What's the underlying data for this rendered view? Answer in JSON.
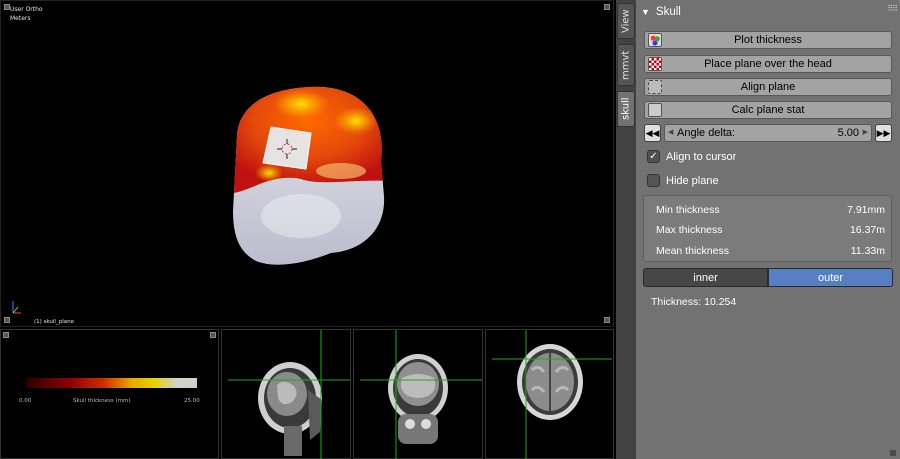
{
  "viewport": {
    "view_name": "User Ortho",
    "units": "Meters",
    "active_object": "(1) skull_plane"
  },
  "colorbar": {
    "min_label": "0.00",
    "title": "Skull thickness (mm)",
    "max_label": "25.00"
  },
  "tabs": [
    {
      "label": "View",
      "active": false
    },
    {
      "label": "mmvt",
      "active": false
    },
    {
      "label": "skull",
      "active": true
    }
  ],
  "panel": {
    "title": "Skull",
    "buttons": {
      "plot": "Plot thickness",
      "place": "Place plane over the head",
      "align": "Align plane",
      "calc": "Calc plane stat"
    },
    "angle": {
      "label": "Angle delta:",
      "value": "5.00"
    },
    "align_to_cursor": {
      "label": "Align to cursor",
      "checked": true
    },
    "hide_plane": {
      "label": "Hide plane",
      "checked": false
    },
    "stats": {
      "min_label": "Min thickness",
      "min_value": "7.91mm",
      "max_label": "Max thickness",
      "max_value": "16.37m",
      "mean_label": "Mean thickness",
      "mean_value": "11.33m"
    },
    "toggle": {
      "inner": "inner",
      "outer": "outer",
      "selected": "outer"
    },
    "thickness_text": "Thickness: 10.254"
  },
  "colors": {
    "panel_bg": "#727272",
    "button_bg": "#a3a3a3",
    "toggle_selected": "#5680c2",
    "crosshair": "#1fa81f"
  }
}
